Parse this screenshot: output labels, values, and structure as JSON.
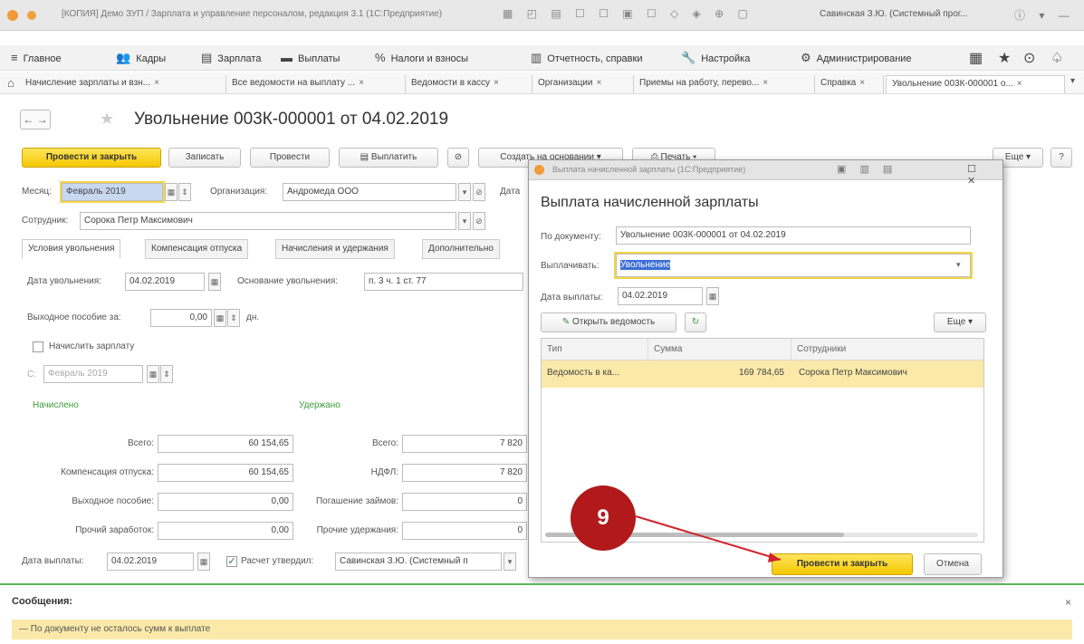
{
  "window": {
    "title": "[КОПИЯ] Демо ЗУП / Зарплата и управление персоналом, редакция 3.1 (1С:Предприятие)",
    "user": "Савинская З.Ю. (Системный прог..."
  },
  "menu": {
    "items": [
      {
        "icon": "≡",
        "label": "Главное"
      },
      {
        "icon": "👥",
        "label": "Кадры"
      },
      {
        "icon": "▤",
        "label": "Зарплата"
      },
      {
        "icon": "▬",
        "label": "Выплаты"
      },
      {
        "icon": "%",
        "label": "Налоги и взносы"
      },
      {
        "icon": "▥",
        "label": "Отчетность, справки"
      },
      {
        "icon": "🔧",
        "label": "Настройка"
      },
      {
        "icon": "⚙",
        "label": "Администрирование"
      }
    ]
  },
  "tabs": [
    {
      "label": "Начисление зарплаты и взн..."
    },
    {
      "label": "Все ведомости на выплату ..."
    },
    {
      "label": "Ведомости в кассу"
    },
    {
      "label": "Организации"
    },
    {
      "label": "Приемы на работу, перево..."
    },
    {
      "label": "Справка"
    },
    {
      "label": "Увольнение 003К-000001 о..."
    }
  ],
  "document": {
    "title": "Увольнение 003К-000001 от 04.02.2019",
    "buttons": {
      "post_close": "Провести и закрыть",
      "save": "Записать",
      "post": "Провести",
      "pay": "Выплатить",
      "create_based": "Создать на основании",
      "print": "Печать",
      "more": "Еще",
      "help": "?"
    },
    "month_label": "Месяц:",
    "month_value": "Февраль 2019",
    "org_label": "Организация:",
    "org_value": "Андромеда ООО",
    "date_label": "Дата",
    "employee_label": "Сотрудник:",
    "employee_value": "Сорока Петр Максимович",
    "inner_tabs": [
      "Условия увольнения",
      "Компенсация отпуска",
      "Начисления и удержания",
      "Дополнительно"
    ],
    "dismissal_date_label": "Дата увольнения:",
    "dismissal_date_value": "04.02.2019",
    "basis_label": "Основание увольнения:",
    "basis_value": "п. 3 ч. 1 ст. 77",
    "severance_label": "Выходное пособие за:",
    "severance_value": "0,00",
    "severance_unit": "дн.",
    "accrue_salary_label": "Начислить зарплату",
    "from_label": "С:",
    "from_value": "Февраль 2019",
    "accrued_header": "Начислено",
    "withheld_header": "Удержано",
    "accrued": [
      {
        "label": "Всего:",
        "value": "60 154,65"
      },
      {
        "label": "Компенсация отпуска:",
        "value": "60 154,65"
      },
      {
        "label": "Выходное пособие:",
        "value": "0,00"
      },
      {
        "label": "Прочий заработок:",
        "value": "0,00"
      }
    ],
    "withheld": [
      {
        "label": "Всего:",
        "value": "7 820"
      },
      {
        "label": "НДФЛ:",
        "value": "7 820"
      },
      {
        "label": "Погашение займов:",
        "value": "0"
      },
      {
        "label": "Прочие удержания:",
        "value": "0"
      }
    ],
    "pay_date_label": "Дата выплаты:",
    "pay_date_value": "04.02.2019",
    "approved_label": "Расчет утвердил:",
    "approved_value": "Савинская З.Ю. (Системный п"
  },
  "dialog": {
    "window_title": "Выплата начисленной зарплаты (1С:Предприятие)",
    "heading": "Выплата начисленной зарплаты",
    "by_doc_label": "По документу:",
    "by_doc_value": "Увольнение 003К-000001 от 04.02.2019",
    "pay_label": "Выплачивать:",
    "pay_value": "Увольнение",
    "pay_date_label": "Дата выплаты:",
    "pay_date_value": "04.02.2019",
    "open_sheet": "Открыть ведомость",
    "more": "Еще",
    "columns": [
      "Тип",
      "Сумма",
      "Сотрудники"
    ],
    "rows": [
      {
        "type": "Ведомость в ка...",
        "sum": "169 784,65",
        "employees": "Сорока Петр Максимович"
      }
    ],
    "post_close": "Провести и закрыть",
    "cancel": "Отмена"
  },
  "annotation": {
    "step": "9"
  },
  "messages": {
    "title": "Сообщения:",
    "text": "— По документу не осталось сумм к выплате"
  }
}
